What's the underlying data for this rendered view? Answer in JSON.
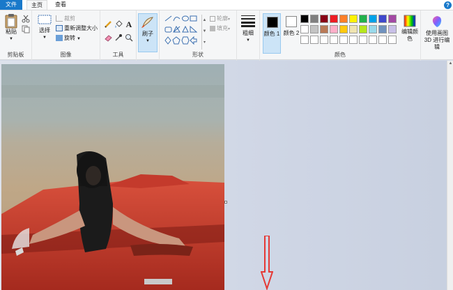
{
  "tabs": {
    "file": "文件",
    "home": "主页",
    "view": "查看"
  },
  "help": "?",
  "clipboard": {
    "paste_label": "粘贴",
    "group_label": "剪贴板"
  },
  "image": {
    "select_label": "选择",
    "crop_label": "裁剪",
    "resize_label": "重新调整大小",
    "rotate_label": "旋转",
    "group_label": "图像"
  },
  "tools": {
    "group_label": "工具",
    "text_glyph": "A"
  },
  "brushes": {
    "label": "刷子"
  },
  "shapes": {
    "outline_label": "轮廓",
    "fill_label": "填充",
    "group_label": "形状"
  },
  "size": {
    "label": "粗细"
  },
  "colors": {
    "color1_label": "颜色 1",
    "color2_label": "颜色 2",
    "edit_label": "编辑颜色",
    "group_label": "颜色",
    "color1": "#000000",
    "color2": "#ffffff",
    "palette": [
      [
        "#000000",
        "#7f7f7f",
        "#880015",
        "#ed1c24",
        "#ff7f27",
        "#fff200",
        "#22b14c",
        "#00a2e8",
        "#3f48cc",
        "#a349a4"
      ],
      [
        "#ffffff",
        "#c3c3c3",
        "#b97a57",
        "#ffaec9",
        "#ffc90e",
        "#efe4b0",
        "#b5e61d",
        "#99d9ea",
        "#7092be",
        "#c8bfe7"
      ],
      [
        "#ffffff",
        "#ffffff",
        "#ffffff",
        "#ffffff",
        "#ffffff",
        "#ffffff",
        "#ffffff",
        "#ffffff",
        "#ffffff",
        "#ffffff"
      ]
    ]
  },
  "paint3d": {
    "label": "使用画图 3D 进行编辑"
  },
  "accent": "#1979ca",
  "annotation_color": "#e53935"
}
